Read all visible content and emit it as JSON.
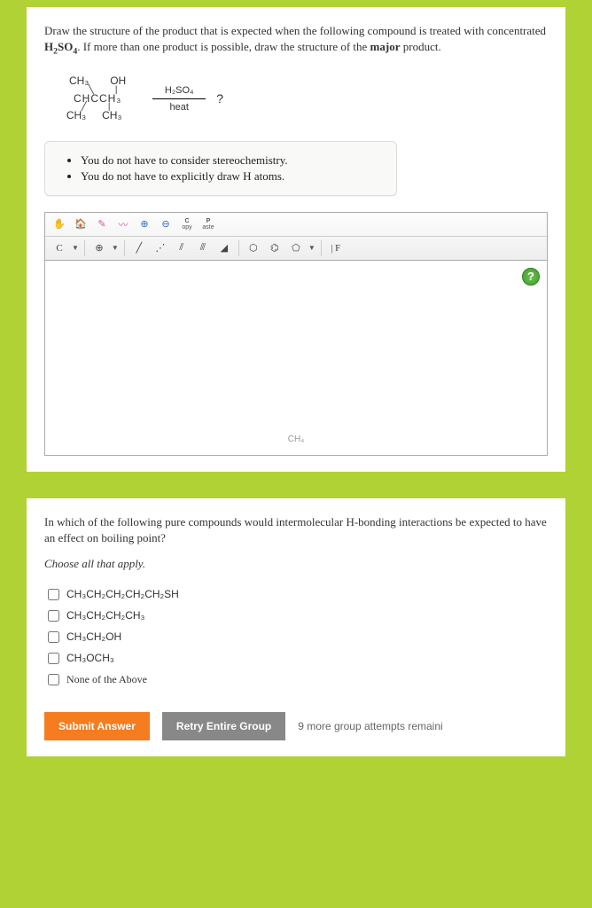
{
  "q1": {
    "prompt_html": "Draw the structure of the product that is expected when the following compound is treated with concentrated <b>H<sub>2</sub>SO<sub>4</sub></b>. If more than one product is possible, draw the structure of the <b>major</b> product.",
    "structure": {
      "oh": "OH",
      "ch3_topleft": "CH₃",
      "ch3_bottomleft": "CH₃",
      "chain": "CHCCH₃",
      "ch3_bottom": "CH₃",
      "reagent_top": "H₂SO₄",
      "reagent_bottom": "heat",
      "product": "?"
    },
    "notes": [
      "You do not have to consider stereochemistry.",
      "You do not have to explicitly draw H atoms."
    ],
    "toolbar": {
      "row1": [
        "hand",
        "home",
        "pencil",
        "lasso",
        "zoomin",
        "zoomout",
        "copy",
        "paste"
      ],
      "copy_label": "C\nopy",
      "paste_label": "P\naste",
      "row2_c": "C",
      "row2_if": "| F"
    },
    "canvas": {
      "help": "?",
      "label": "CH₄"
    }
  },
  "q2": {
    "prompt": "In which of the following pure compounds would intermolecular H-bonding interactions be expected to have an effect on boiling point?",
    "instruct": "Choose all that apply.",
    "options": [
      "CH₃CH₂CH₂CH₂CH₂SH",
      "CH₃CH₂CH₂CH₃",
      "CH₃CH₂OH",
      "CH₃OCH₃",
      "None of the Above"
    ]
  },
  "actions": {
    "submit": "Submit Answer",
    "retry": "Retry Entire Group",
    "attempts": "9 more group attempts remaini"
  }
}
